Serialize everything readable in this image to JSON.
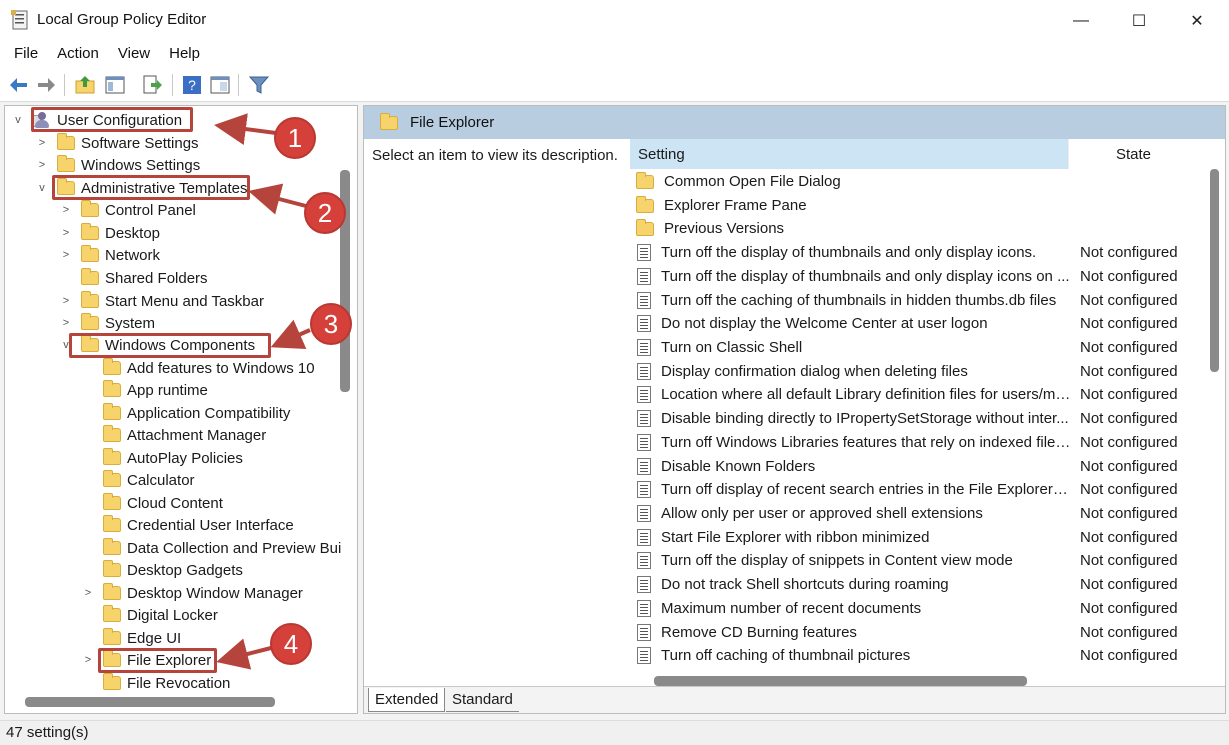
{
  "window": {
    "title": "Local Group Policy Editor",
    "controls": [
      "—",
      "☐",
      "✕"
    ]
  },
  "menu": [
    "File",
    "Action",
    "View",
    "Help"
  ],
  "tree": {
    "items": [
      {
        "label": "User Configuration",
        "expand": "v",
        "icon": "user-config-icon"
      },
      {
        "label": "Software Settings",
        "expand": ">",
        "icon": "folder-icon"
      },
      {
        "label": "Windows Settings",
        "expand": ">",
        "icon": "folder-icon"
      },
      {
        "label": "Administrative Templates",
        "expand": "v",
        "icon": "folder-icon"
      },
      {
        "label": "Control Panel",
        "expand": ">",
        "icon": "folder-icon"
      },
      {
        "label": "Desktop",
        "expand": ">",
        "icon": "folder-icon"
      },
      {
        "label": "Network",
        "expand": ">",
        "icon": "folder-icon"
      },
      {
        "label": "Shared Folders",
        "expand": "",
        "icon": "folder-icon"
      },
      {
        "label": "Start Menu and Taskbar",
        "expand": ">",
        "icon": "folder-icon"
      },
      {
        "label": "System",
        "expand": ">",
        "icon": "folder-icon"
      },
      {
        "label": "Windows Components",
        "expand": "v",
        "icon": "folder-icon"
      },
      {
        "label": "Add features to Windows 10",
        "expand": "",
        "icon": "folder-icon"
      },
      {
        "label": "App runtime",
        "expand": "",
        "icon": "folder-icon"
      },
      {
        "label": "Application Compatibility",
        "expand": "",
        "icon": "folder-icon"
      },
      {
        "label": "Attachment Manager",
        "expand": "",
        "icon": "folder-icon"
      },
      {
        "label": "AutoPlay Policies",
        "expand": "",
        "icon": "folder-icon"
      },
      {
        "label": "Calculator",
        "expand": "",
        "icon": "folder-icon"
      },
      {
        "label": "Cloud Content",
        "expand": "",
        "icon": "folder-icon"
      },
      {
        "label": "Credential User Interface",
        "expand": "",
        "icon": "folder-icon"
      },
      {
        "label": "Data Collection and Preview Bui",
        "expand": "",
        "icon": "folder-icon"
      },
      {
        "label": "Desktop Gadgets",
        "expand": "",
        "icon": "folder-icon"
      },
      {
        "label": "Desktop Window Manager",
        "expand": ">",
        "icon": "folder-icon"
      },
      {
        "label": "Digital Locker",
        "expand": "",
        "icon": "folder-icon"
      },
      {
        "label": "Edge UI",
        "expand": "",
        "icon": "folder-icon"
      },
      {
        "label": "File Explorer",
        "expand": ">",
        "icon": "folder-icon"
      },
      {
        "label": "File Revocation",
        "expand": "",
        "icon": "folder-icon"
      }
    ]
  },
  "callouts": [
    "1",
    "2",
    "3",
    "4"
  ],
  "details": {
    "header_title": "File Explorer",
    "description": "Select an item to view its description.",
    "columns": {
      "setting": "Setting",
      "state": "State"
    },
    "rows": [
      {
        "name": "Common Open File Dialog",
        "state": "",
        "type": "folder"
      },
      {
        "name": "Explorer Frame Pane",
        "state": "",
        "type": "folder"
      },
      {
        "name": "Previous Versions",
        "state": "",
        "type": "folder"
      },
      {
        "name": "Turn off the display of thumbnails and only display icons.",
        "state": "Not configured",
        "type": "policy"
      },
      {
        "name": "Turn off the display of thumbnails and only display icons on ...",
        "state": "Not configured",
        "type": "policy"
      },
      {
        "name": "Turn off the caching of thumbnails in hidden thumbs.db files",
        "state": "Not configured",
        "type": "policy"
      },
      {
        "name": "Do not display the Welcome Center at user logon",
        "state": "Not configured",
        "type": "policy"
      },
      {
        "name": "Turn on Classic Shell",
        "state": "Not configured",
        "type": "policy"
      },
      {
        "name": "Display confirmation dialog when deleting files",
        "state": "Not configured",
        "type": "policy"
      },
      {
        "name": "Location where all default Library definition files for users/ma...",
        "state": "Not configured",
        "type": "policy"
      },
      {
        "name": "Disable binding directly to IPropertySetStorage without inter...",
        "state": "Not configured",
        "type": "policy"
      },
      {
        "name": "Turn off Windows Libraries features that rely on indexed file ...",
        "state": "Not configured",
        "type": "policy"
      },
      {
        "name": "Disable Known Folders",
        "state": "Not configured",
        "type": "policy"
      },
      {
        "name": "Turn off display of recent search entries in the File Explorer se...",
        "state": "Not configured",
        "type": "policy"
      },
      {
        "name": "Allow only per user or approved shell extensions",
        "state": "Not configured",
        "type": "policy"
      },
      {
        "name": "Start File Explorer with ribbon minimized",
        "state": "Not configured",
        "type": "policy"
      },
      {
        "name": "Turn off the display of snippets in Content view mode",
        "state": "Not configured",
        "type": "policy"
      },
      {
        "name": "Do not track Shell shortcuts during roaming",
        "state": "Not configured",
        "type": "policy"
      },
      {
        "name": "Maximum number of recent documents",
        "state": "Not configured",
        "type": "policy"
      },
      {
        "name": "Remove CD Burning features",
        "state": "Not configured",
        "type": "policy"
      },
      {
        "name": "Turn off caching of thumbnail pictures",
        "state": "Not configured",
        "type": "policy"
      }
    ]
  },
  "tabs": [
    "Extended",
    "Standard"
  ],
  "status": "47 setting(s)",
  "toolbar": [
    "back-arrow-icon",
    "forward-arrow-icon",
    "up-folder-icon",
    "show-hide-tree-icon",
    "export-list-icon",
    "help-icon",
    "properties-icon",
    "filter-icon"
  ],
  "colors": {
    "highlight": "#b5443c",
    "callout": "#d6403a",
    "header": "#b9cde0",
    "column-header": "#cde4f4"
  }
}
